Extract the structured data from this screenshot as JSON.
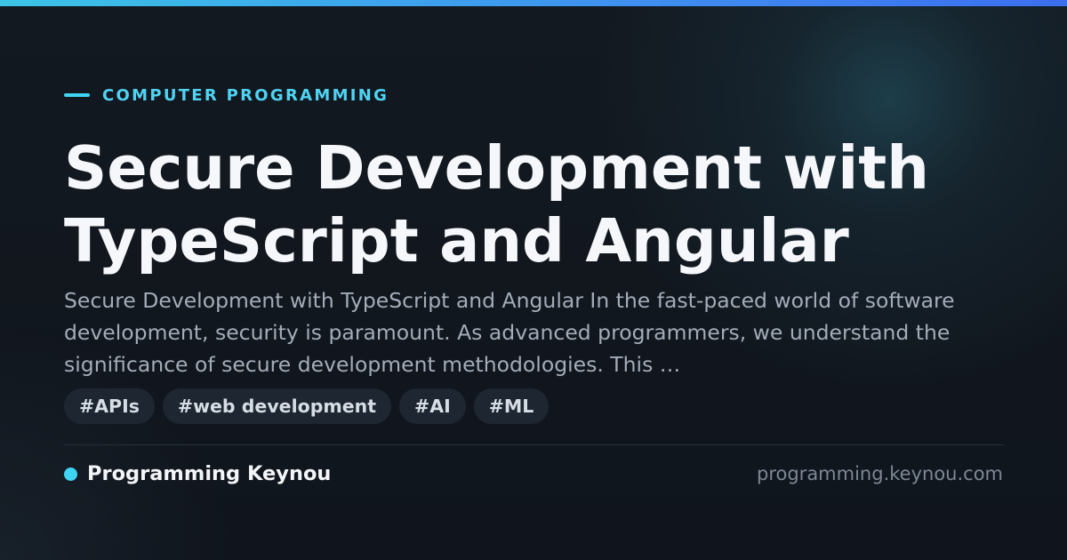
{
  "colors": {
    "accent": "#3fd4f2",
    "accent_gradient_end": "#3c6ef0",
    "background": "#10151d",
    "title": "#f5f7fa",
    "excerpt": "#a3acb8",
    "tag_background": "#1e2731",
    "muted": "#7d8794"
  },
  "category": {
    "label": "COMPUTER PROGRAMMING"
  },
  "article": {
    "title": "Secure Development with TypeScript and Angular",
    "excerpt": "Secure Development with TypeScript and Angular In the fast-paced world of software development, security is paramount. As advanced programmers, we understand the significance of secure development methodologies. This …"
  },
  "tags": [
    "#APIs",
    "#web development",
    "#AI",
    "#ML"
  ],
  "footer": {
    "brand_name": "Programming Keynou",
    "domain": "programming.keynou.com"
  }
}
